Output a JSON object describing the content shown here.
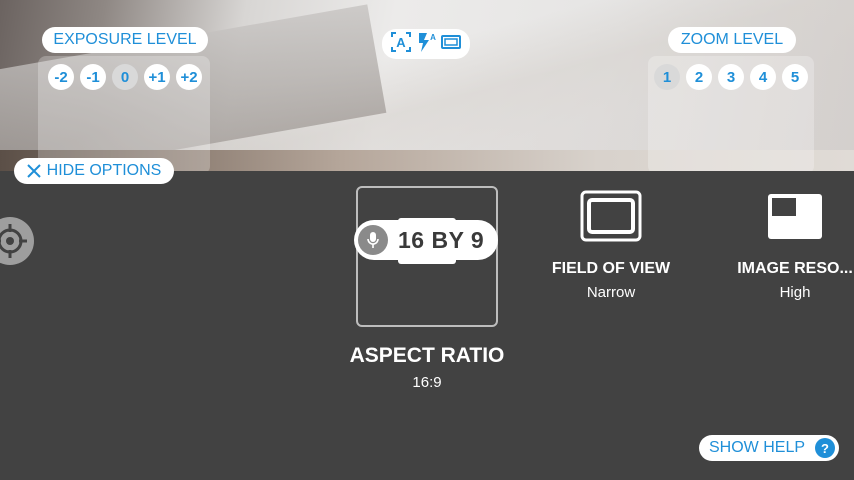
{
  "exposure": {
    "label": "EXPOSURE LEVEL",
    "levels": [
      "-2",
      "-1",
      "0",
      "+1",
      "+2"
    ],
    "selected": "0"
  },
  "zoom": {
    "label": "ZOOM LEVEL",
    "levels": [
      "1",
      "2",
      "3",
      "4",
      "5"
    ],
    "selected": "1"
  },
  "mode_icons": [
    "auto-focus-icon",
    "auto-flash-icon",
    "aspect-frame-icon"
  ],
  "hide_options": {
    "label": "HIDE OPTIONS",
    "icon": "close-icon"
  },
  "settings": {
    "aspect_ratio": {
      "title": "ASPECT RATIO",
      "value": "16:9",
      "voice_label": "16 BY 9"
    },
    "field_of_view": {
      "title": "FIELD OF VIEW",
      "value": "Narrow"
    },
    "image_resolution": {
      "title": "IMAGE RESO...",
      "value": "High"
    }
  },
  "show_help": {
    "label": "SHOW HELP",
    "icon": "help-icon"
  },
  "colors": {
    "accent": "#1f8fd8",
    "panel_bg": "#424242"
  }
}
